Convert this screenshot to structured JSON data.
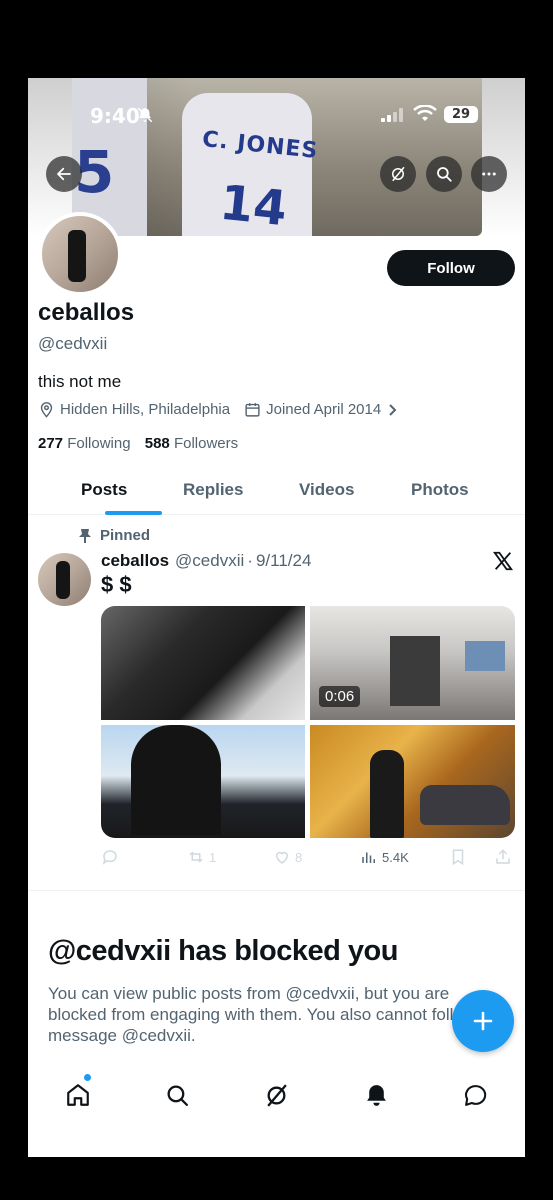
{
  "status_bar": {
    "time": "9:40",
    "battery": "29"
  },
  "banner": {
    "jersey_text": "C. JONES",
    "jersey_number": "14",
    "left_number": "5"
  },
  "profile": {
    "name": "ceballos",
    "handle": "@cedvxii",
    "bio": "this not me",
    "location": "Hidden Hills, Philadelphia",
    "joined": "Joined April 2014",
    "following_count": "277",
    "following_label": "Following",
    "followers_count": "588",
    "followers_label": "Followers",
    "follow_button": "Follow"
  },
  "tabs": [
    {
      "label": "Posts",
      "active": true
    },
    {
      "label": "Replies",
      "active": false
    },
    {
      "label": "Videos",
      "active": false
    },
    {
      "label": "Photos",
      "active": false
    }
  ],
  "post": {
    "pinned_label": "Pinned",
    "author_name": "ceballos",
    "author_handle": "@cedvxii",
    "separator": "·",
    "date": "9/11/24",
    "text": "$ $",
    "video_duration": "0:06",
    "reply_count": "",
    "repost_count": "1",
    "like_count": "8",
    "view_count": "5.4K"
  },
  "blocked": {
    "title": "@cedvxii has blocked you",
    "body": "You can view public posts from @cedvxii, but you are blocked from engaging with them. You also cannot follow or message @cedvxii."
  },
  "colors": {
    "accent": "#1d9bf0",
    "text": "#0f1419",
    "muted": "#536471"
  }
}
